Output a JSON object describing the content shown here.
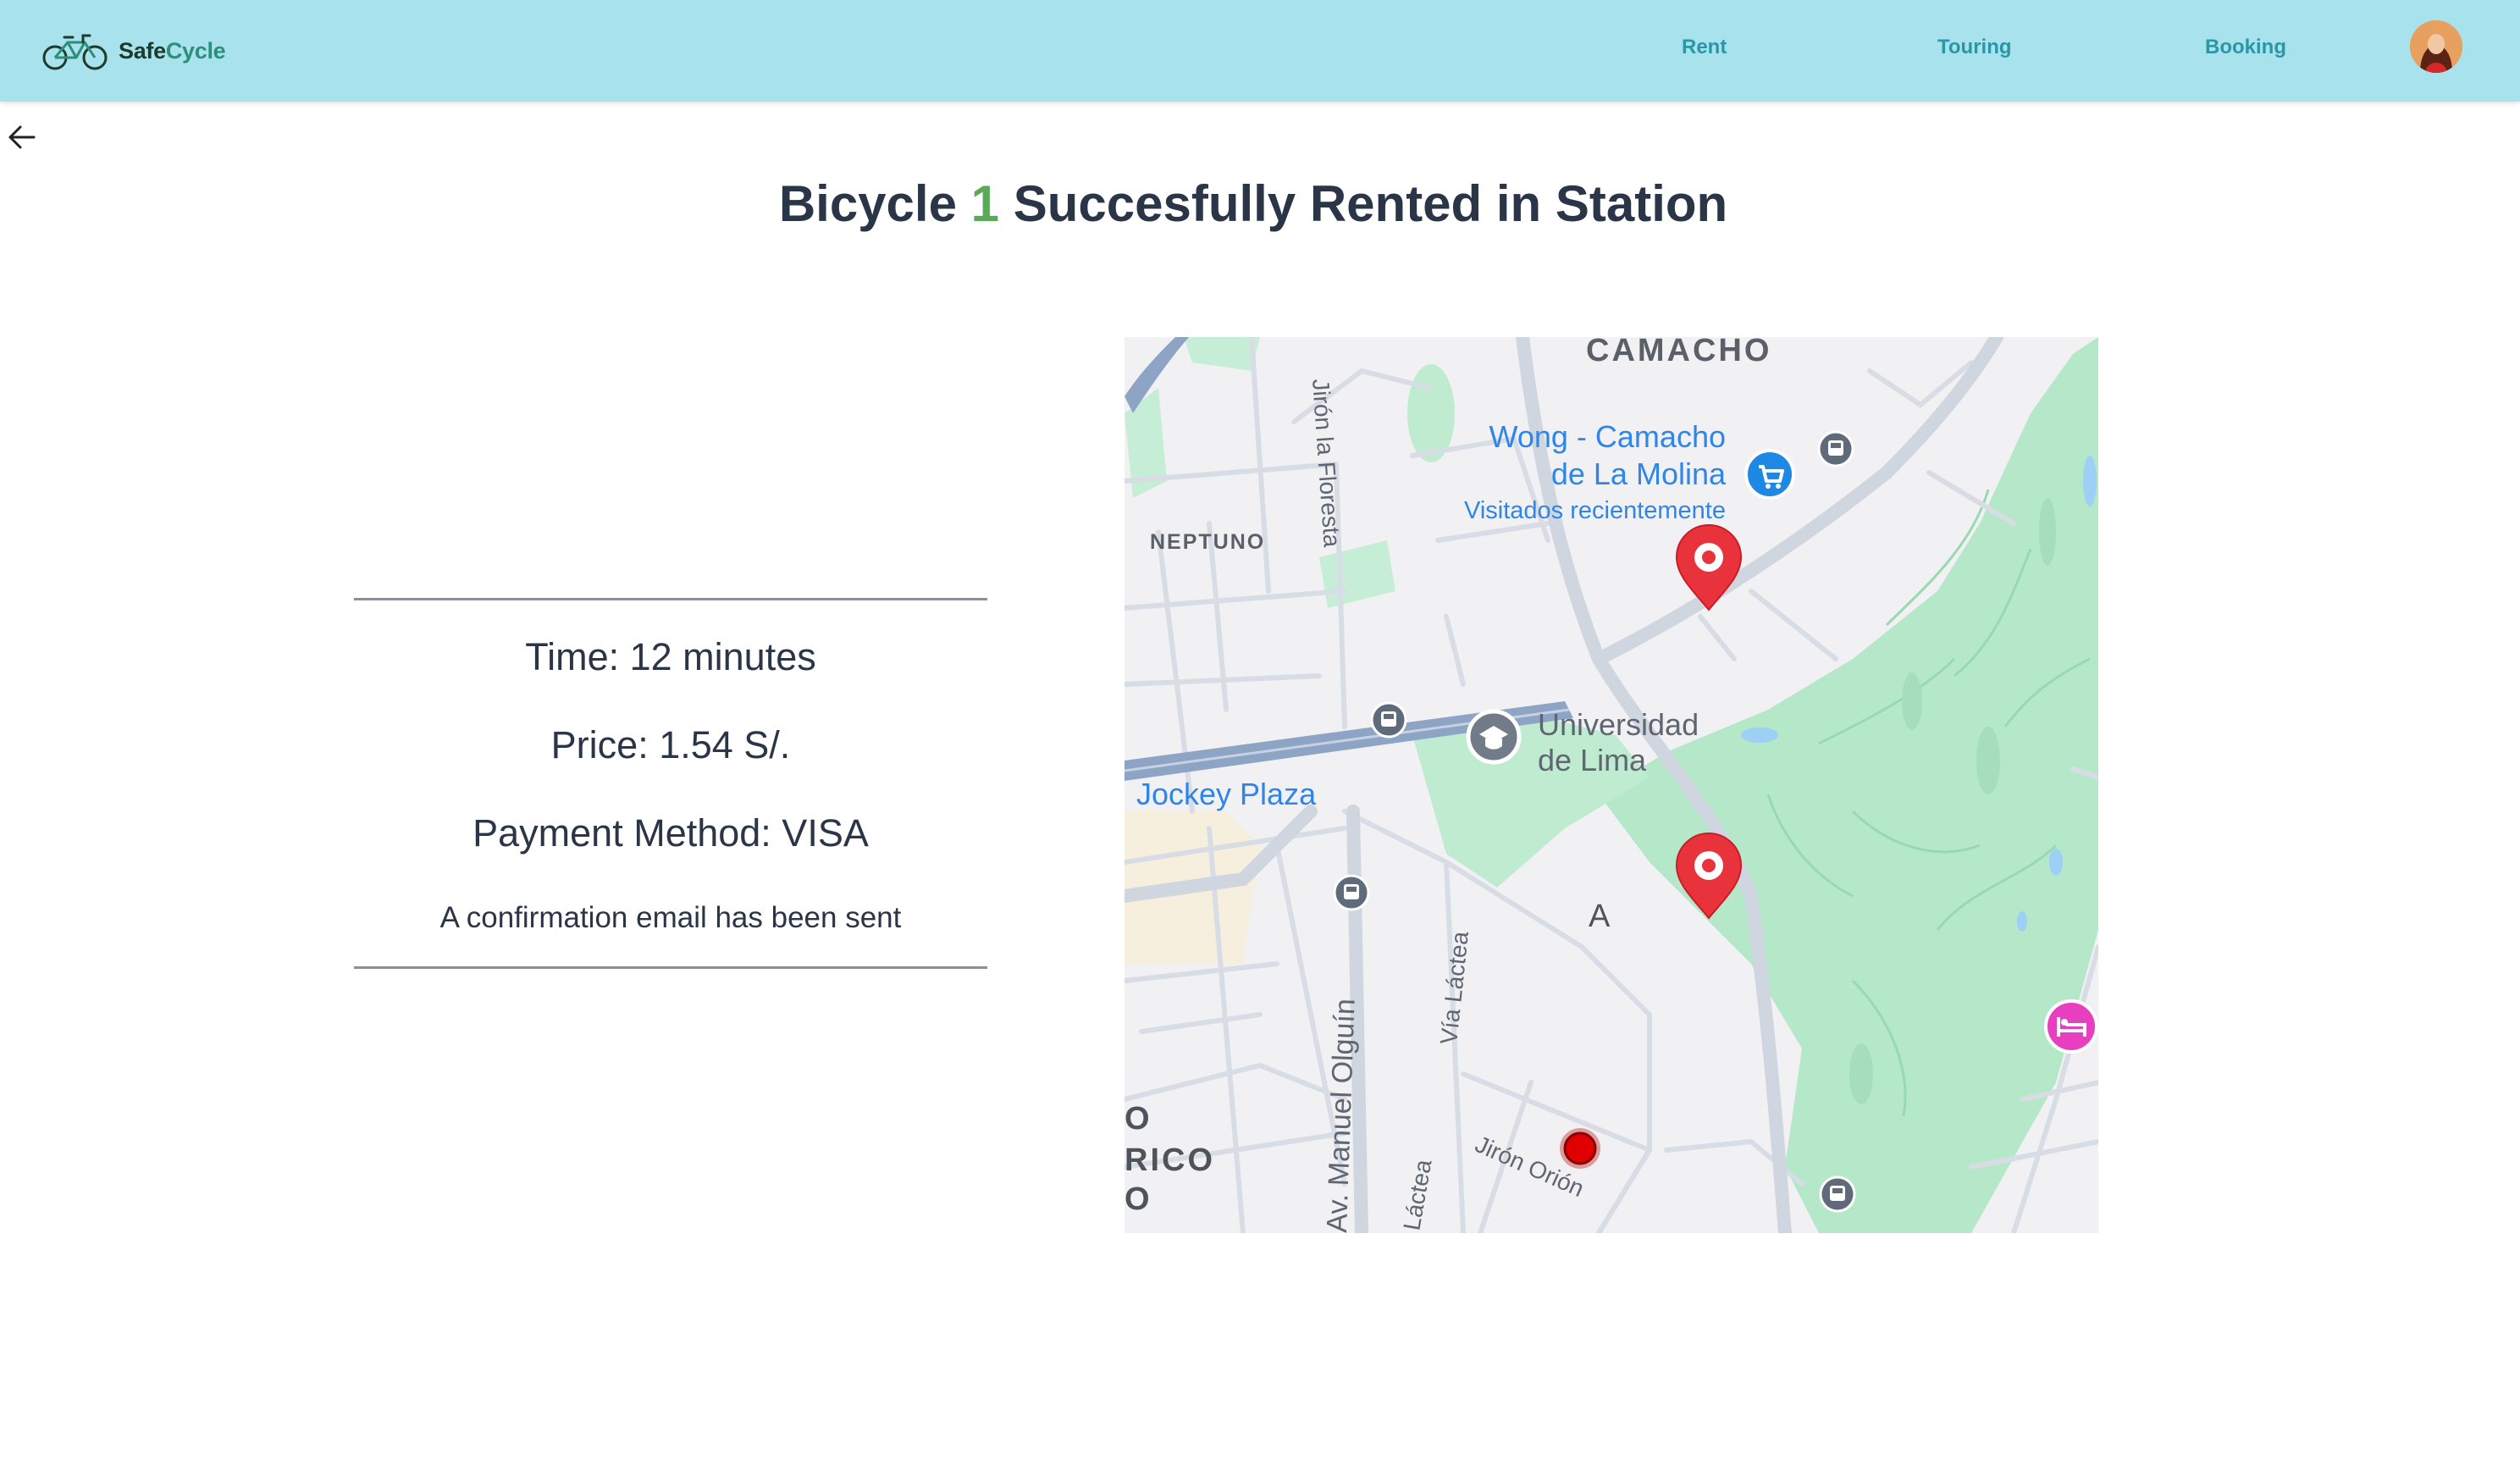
{
  "brand": {
    "name_part1": "Safe",
    "name_part2": "Cycle"
  },
  "nav": {
    "rent": "Rent",
    "touring": "Touring",
    "booking": "Booking"
  },
  "title": {
    "prefix": "Bicycle",
    "number": "1",
    "suffix": "Succesfully Rented in Station"
  },
  "details": {
    "time": "Time: 12 minutes",
    "price": "Price: 1.54 S/.",
    "payment": "Payment Method: VISA",
    "confirmation": "A confirmation email has been sent"
  },
  "map": {
    "labels": {
      "camacho": "CAMACHO",
      "neptuno": "NEPTUNO",
      "wong_line1": "Wong - Camacho",
      "wong_line2": "de La Molina",
      "visited": "Visitados recientemente",
      "univ_line1": "Universidad",
      "univ_line2": "de Lima",
      "jockey": "Jockey Plaza",
      "letter_a": "A",
      "floresta": "Jirón la Floresta",
      "via_lactea": "Vía Láctea",
      "via_lactea_cut": "Láctea",
      "olguin": "Av. Manuel Olguín",
      "orion": "Jirón Orión",
      "edge_1": "O",
      "edge_2": "RICO",
      "edge_3": "O"
    },
    "colors": {
      "park": "#b5e8c9",
      "road": "#d2d8e0",
      "highway": "#8ea4c4",
      "pin": "#e8323c",
      "accent_blue": "#2f86e8"
    }
  },
  "colors": {
    "header_bg": "#a8e2ec",
    "nav_link": "#2a96a6",
    "title_accent": "#5aa957",
    "text": "#2a3547"
  }
}
